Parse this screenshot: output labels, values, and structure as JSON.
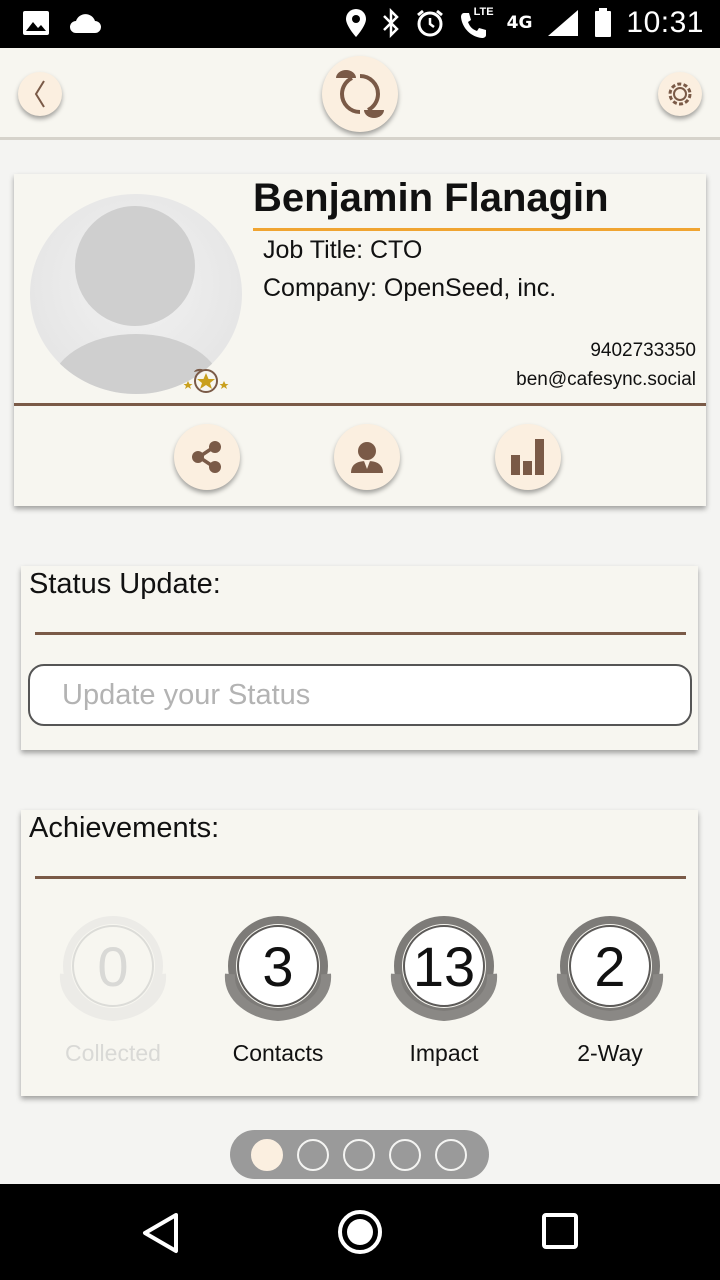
{
  "status_bar": {
    "time": "10:31",
    "network": "4G",
    "lte": "LTE",
    "icons": [
      "image-icon",
      "cloud-icon",
      "location-icon",
      "bluetooth-icon",
      "alarm-icon",
      "lte-call-icon",
      "signal-icon",
      "battery-icon"
    ]
  },
  "app_bar": {
    "icons": [
      "back-icon",
      "cafesync-logo-icon",
      "gear-icon"
    ]
  },
  "profile": {
    "name": "Benjamin Flanagin",
    "job_title": "Job Title: CTO",
    "company": "Company: OpenSeed, inc.",
    "phone": "9402733350",
    "email": "ben@cafesync.social",
    "actions": [
      "share-icon",
      "contact-icon",
      "stats-icon"
    ]
  },
  "status_update": {
    "title": "Status Update:",
    "placeholder": "Update your Status",
    "value": ""
  },
  "achievements": {
    "title": "Achievements:",
    "items": [
      {
        "value": "0",
        "label": "Collected"
      },
      {
        "value": "3",
        "label": "Contacts"
      },
      {
        "value": "13",
        "label": "Impact"
      },
      {
        "value": "2",
        "label": "2-Way"
      }
    ]
  },
  "pager": {
    "pages": 5,
    "current": 1
  },
  "colors": {
    "accent": "#f0a431",
    "brown": "#7a5a47",
    "button_fill": "#fbefe0",
    "card_bg": "#f7f6f0"
  }
}
